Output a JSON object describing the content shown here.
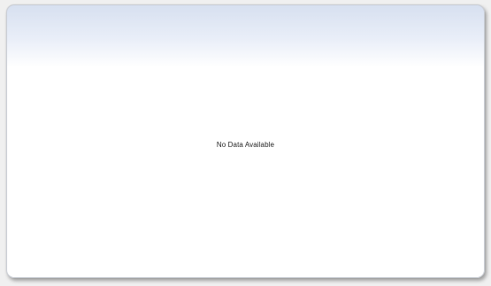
{
  "panel": {
    "message": "No Data Available"
  }
}
